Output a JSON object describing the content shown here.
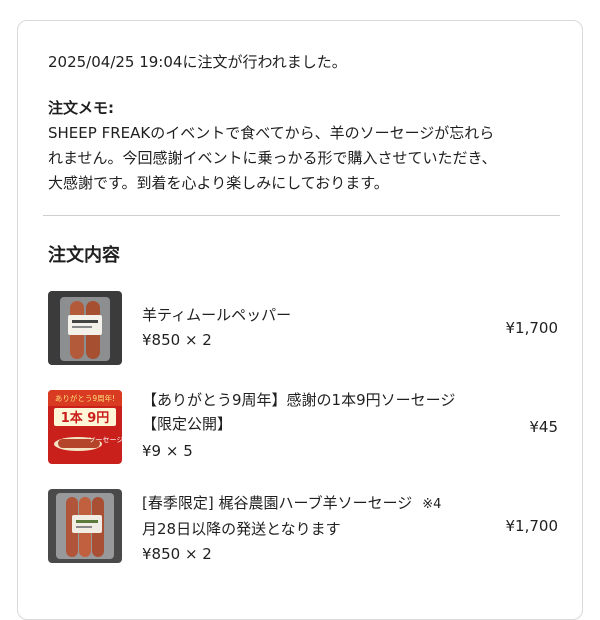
{
  "order": {
    "timestamp_line": "2025/04/25 19:04に注文が行われました。",
    "memo_title": "注文メモ:",
    "memo_lines": [
      "SHEEP FREAKのイベントで食べてから、羊のソーセージが忘れら",
      "れません。今回感謝イベントに乗っかる形で購入させていただき、",
      "大感謝です。到着を心より楽しみにしております。"
    ]
  },
  "section_title": "注文内容",
  "items": [
    {
      "name_lines": [
        "羊ティムールペッパー"
      ],
      "qty": "¥850 × 2",
      "price": "¥1,700"
    },
    {
      "name_lines": [
        "【ありがとう9周年】感謝の1本9円ソーセージ",
        "【限定公開】"
      ],
      "qty": "¥9 × 5",
      "price": "¥45",
      "thumb_text": {
        "top": "ありがとう9周年!",
        "mid": "1本 9円",
        "bottom": "ソーセージ"
      }
    },
    {
      "name_lines": [
        "[春季限定] 梶谷農園ハーブ羊ソーセージ",
        "月28日以降の発送となります"
      ],
      "note": "※4",
      "qty": "¥850 × 2",
      "price": "¥1,700"
    }
  ]
}
